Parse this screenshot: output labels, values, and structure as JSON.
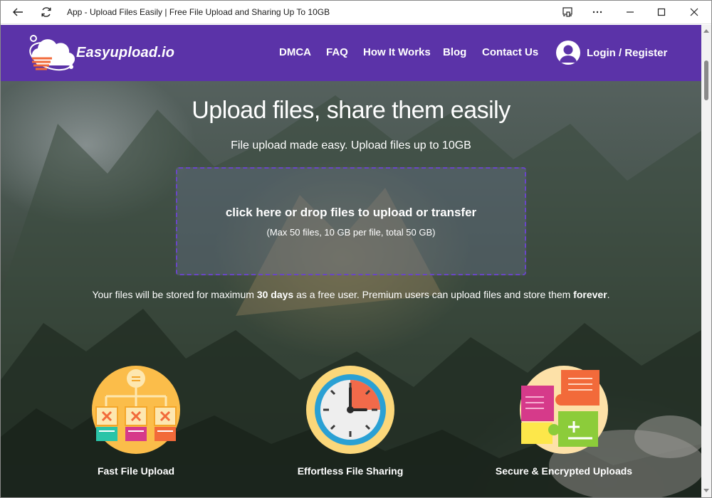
{
  "window": {
    "title": "App - Upload Files Easily | Free File Upload and Sharing Up To 10GB"
  },
  "site": {
    "brand": "Easyupload.io",
    "nav": {
      "dmca": "DMCA",
      "faq": "FAQ",
      "how_it_works": "How It Works",
      "blog": "Blog",
      "contact": "Contact Us",
      "login": "Login / Register"
    }
  },
  "hero": {
    "title": "Upload files, share them easily",
    "subtitle": "File upload made easy. Upload files up to 10GB",
    "dropzone_main": "click here or drop files to upload or transfer",
    "dropzone_sub": "(Max 50 files, 10 GB per file, total 50 GB)",
    "storage_part1": "Your files will be stored for maximum ",
    "storage_bold1": "30 days",
    "storage_part2": " as a free user. Premium users can upload files and store them ",
    "storage_bold2": "forever",
    "storage_part3": "."
  },
  "features": [
    {
      "label": "Fast File Upload",
      "icon": "flowchart-icon"
    },
    {
      "label": "Effortless File Sharing",
      "icon": "clock-icon"
    },
    {
      "label": "Secure & Encrypted Uploads",
      "icon": "puzzle-icon"
    }
  ],
  "colors": {
    "navbar": "#5b33a8",
    "dropzone_border": "#6a45c8"
  }
}
